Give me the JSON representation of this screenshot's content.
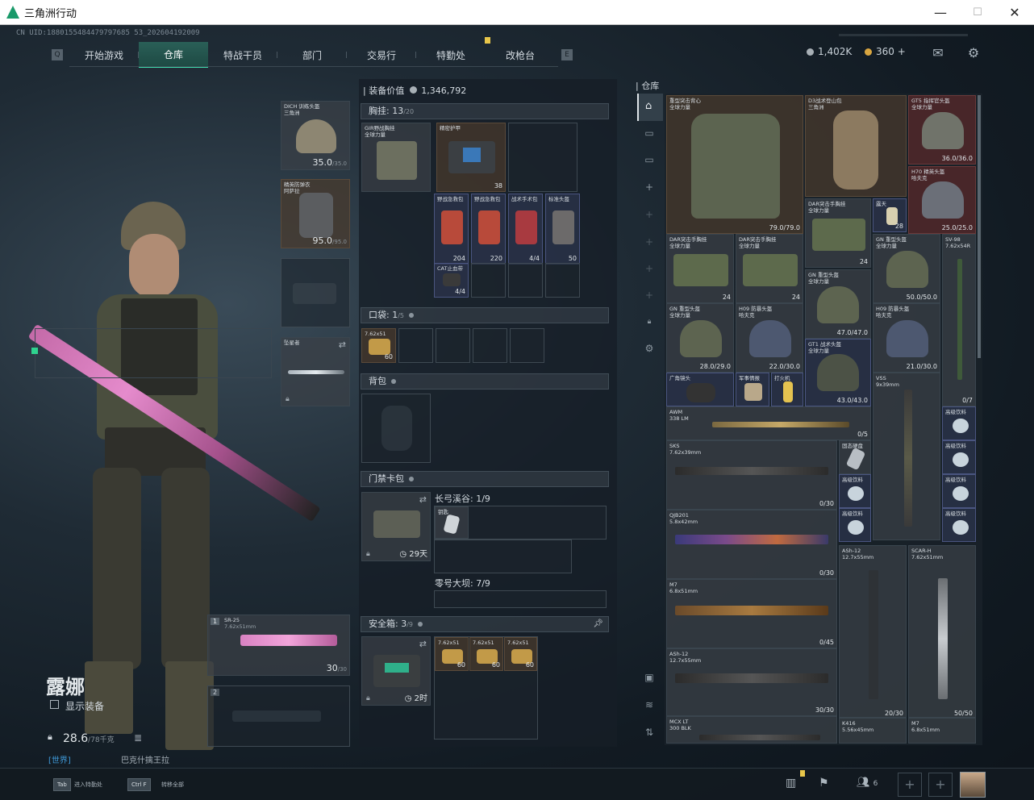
{
  "window": {
    "title": "三角洲行动",
    "minimize": "—",
    "maximize": "☐",
    "close": "✕"
  },
  "uid": "CN UID:1880155484479797685 53_202604192009",
  "nav": {
    "tabs": [
      "开始游戏",
      "仓库",
      "特战干员",
      "部门",
      "交易行",
      "特勤处",
      "改枪台"
    ],
    "active": "仓库"
  },
  "currency": {
    "coins": "1,402K",
    "tickets": "360",
    "plus": "+"
  },
  "operator": {
    "name": "露娜",
    "show_equipment": "显示装备",
    "weight": "28.6",
    "weight_max": "/78千克",
    "title_line1": "[世界]",
    "title_line2": "巴克什擒王拉"
  },
  "gear": {
    "helmet": {
      "name": "DICH 训练头盔\n三角洲",
      "value": "35.0",
      "max": "/35.0"
    },
    "armor": {
      "name": "精英防弹衣\n阿萨拉",
      "value": "95.0",
      "max": "/95.0"
    },
    "melee": {
      "name": "坠星者"
    },
    "weapon1": {
      "slot": "1",
      "name": "SR-25",
      "caliber": "7.62x51mm",
      "ammo": "30",
      "ammo_max": "/30"
    },
    "weapon2": {
      "slot": "2"
    }
  },
  "equip_value": {
    "label": "装备价值",
    "value": "1,346,792"
  },
  "chest": {
    "label": "胸挂:",
    "value": "13",
    "max": "/20",
    "rig_name": "GIR野战胸挂\n全球力量",
    "pack_name": "精密护甲",
    "pack_count": "38",
    "items": [
      {
        "name": "野战急救包",
        "count": "204"
      },
      {
        "name": "野战急救包",
        "count": "220"
      },
      {
        "name": "战术手术包",
        "count": "4/4"
      },
      {
        "name": "标准头盔",
        "count": "50"
      }
    ],
    "cat_name": "CAT止血带",
    "cat_count": "4/4"
  },
  "pocket": {
    "label": "口袋:",
    "value": "1",
    "max": "/5",
    "ammo_name": "7.62x51",
    "ammo_count": "60"
  },
  "backpack": {
    "label": "背包"
  },
  "keycard": {
    "label": "门禁卡包",
    "timer": "29天",
    "area1": "长弓溪谷:",
    "area1_val": "1/9",
    "area1_item": "钥匙",
    "area2": "零号大坝:",
    "area2_val": "7/9"
  },
  "safe": {
    "label": "安全箱:",
    "value": "3",
    "max": "/9",
    "timer": "2时",
    "ammo_name": "7.62x51",
    "ammo_count": "60"
  },
  "storage": {
    "label": "仓库",
    "items": [
      {
        "name": "重型突击背心\n全球力量",
        "val": "79.0/79.0"
      },
      {
        "name": "D3战术登山包\n三角洲",
        "val": ""
      },
      {
        "name": "GT5 指挥官头盔\n全球力量",
        "val": "36.0/36.0"
      },
      {
        "name": "H70 精英头盔\n哈夫克",
        "val": "25.0/25.0"
      },
      {
        "name": "DAR突击手胸挂\n全球力量",
        "val": "24"
      },
      {
        "name": "露天",
        "val": "28"
      },
      {
        "name": "DAR突击手胸挂\n全球力量",
        "val": "24"
      },
      {
        "name": "DAR突击手胸挂\n全球力量",
        "val": "24"
      },
      {
        "name": "GN 重型头盔\n全球力量",
        "val": "50.0/50.0"
      },
      {
        "name": "SV-98\n7.62x54R",
        "val": "0/7"
      },
      {
        "name": "GN 重型头盔\n全球力量",
        "val": "47.0/47.0"
      },
      {
        "name": "GN 重型头盔\n全球力量",
        "val": "28.0/29.0"
      },
      {
        "name": "H09 防暴头盔\n哈夫克",
        "val": "22.0/30.0"
      },
      {
        "name": "H09 防暴头盔\n哈夫克",
        "val": "21.0/30.0"
      },
      {
        "name": "GT1 战术头盔\n全球力量",
        "val": "43.0/43.0"
      },
      {
        "name": "广角镜头",
        "val": ""
      },
      {
        "name": "军事情报",
        "val": ""
      },
      {
        "name": "打火机",
        "val": ""
      },
      {
        "name": "VSS\n9x39mm",
        "val": ""
      },
      {
        "name": "AWM\n338 LM",
        "val": "0/5"
      },
      {
        "name": "SKS\n7.62x39mm",
        "val": "0/30"
      },
      {
        "name": "固态硬盘",
        "val": ""
      },
      {
        "name": "QJB201\n5.8x42mm",
        "val": "0/30"
      },
      {
        "name": "ASh-12\n12.7x55mm",
        "val": "0/45"
      },
      {
        "name": "SCAR-H\n7.62x51mm",
        "val": ""
      },
      {
        "name": "M7\n6.8x51mm",
        "val": "0/45"
      },
      {
        "name": "ASh-12\n12.7x55mm",
        "val": "30/30"
      },
      {
        "name": "MCX LT\n300 BLK",
        "val": ""
      },
      {
        "name": "K416\n5.56x45mm",
        "val": "20/30"
      },
      {
        "name": "M7\n6.8x51mm",
        "val": "50/50"
      },
      {
        "name": "高级饮料",
        "val": ""
      },
      {
        "name": "高级饮料",
        "val": ""
      },
      {
        "name": "高级饮料",
        "val": ""
      },
      {
        "name": "高级饮料",
        "val": ""
      },
      {
        "name": "高级饮料",
        "val": ""
      },
      {
        "name": "高级饮料",
        "val": ""
      }
    ]
  },
  "bottom": {
    "tab_key": "Tab",
    "tab_hint": "进入特勤处",
    "ctrlf_key": "Ctrl F",
    "ctrlf_hint": "转移全部",
    "squad": "6"
  },
  "colors": {
    "accent": "#3fe0b0",
    "gold": "#e8c64a",
    "panel": "#161e26"
  }
}
